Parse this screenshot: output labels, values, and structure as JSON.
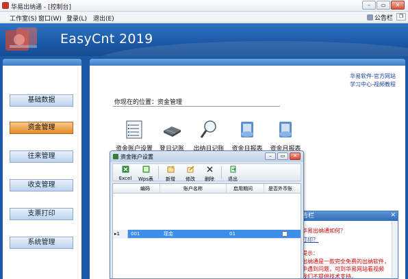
{
  "window": {
    "title": "华易出纳通 - [控制台]",
    "controls": {
      "minimize": "–",
      "restore": "▭",
      "close": "✕"
    }
  },
  "menubar": {
    "items": [
      "工作室(S)",
      "窗口(W)",
      "登录(L)",
      "退出(E)"
    ],
    "notice_label": "公告栏",
    "mini_restore": "❐"
  },
  "banner": {
    "brand": "EasyCnt 2019"
  },
  "sidebar": {
    "items": [
      {
        "label": "基础数据",
        "active": false
      },
      {
        "label": "资金管理",
        "active": true
      },
      {
        "label": "往来管理",
        "active": false
      },
      {
        "label": "收支管理",
        "active": false
      },
      {
        "label": "支票打印",
        "active": false
      },
      {
        "label": "系统管理",
        "active": false
      }
    ]
  },
  "main": {
    "links": [
      "华易软件-官方网站",
      "学习中心-视频教程"
    ],
    "location": "你现在的位置：资金管理",
    "modules": [
      {
        "label": "资金账户设置",
        "icon": "account-settings-icon"
      },
      {
        "label": "登日记账",
        "icon": "ledger-icon"
      },
      {
        "label": "出纳日记账",
        "icon": "magnifier-icon"
      },
      {
        "label": "资金日报表",
        "icon": "daily-report-icon"
      },
      {
        "label": "资金月报表",
        "icon": "monthly-report-icon"
      }
    ]
  },
  "dialog": {
    "title": "资金账户设置",
    "controls": {
      "minimize": "–",
      "restore": "▭",
      "close": "✕"
    },
    "toolbar": [
      {
        "label": "Excel",
        "icon": "excel-icon",
        "color": "#2e8b3a"
      },
      {
        "label": "Wps表",
        "icon": "wps-icon",
        "color": "#3fa535"
      },
      {
        "label": "新增",
        "icon": "add-icon",
        "color": "#e0b030"
      },
      {
        "label": "修改",
        "icon": "edit-icon",
        "color": "#c78a1c"
      },
      {
        "label": "删除",
        "icon": "delete-icon",
        "color": "#333333"
      },
      {
        "label": "退出",
        "icon": "exit-icon",
        "color": "#2f8d47"
      }
    ],
    "grid": {
      "columns": [
        "编码",
        "账户名称",
        "启用期间",
        "是否外币账"
      ],
      "rows": [
        {
          "row_header": "▸1",
          "code": "001",
          "name": "现金",
          "period": "01",
          "foreign": false
        }
      ]
    }
  },
  "notice_panel": {
    "title": "告栏",
    "close": "✕",
    "lines": [
      {
        "text": "华易出纳通如何？",
        "color": "#cc0000"
      },
      {
        "text": "打印？",
        "color": "#1a3fa0"
      },
      {
        "text": "提示：",
        "color": "#cc0000"
      },
      {
        "text": "出纳通是一款完全免费的出纳软件，",
        "color": "#cc0000"
      },
      {
        "text": "中遇到问题，可到华易网站看视频",
        "color": "#cc0000"
      },
      {
        "text": "我们不提供技术支持。",
        "color": "#cc0000"
      }
    ]
  },
  "colors": {
    "banner": "#1d5aa8",
    "nav_active": "#e58b2a",
    "selection": "#3d8ee9"
  }
}
